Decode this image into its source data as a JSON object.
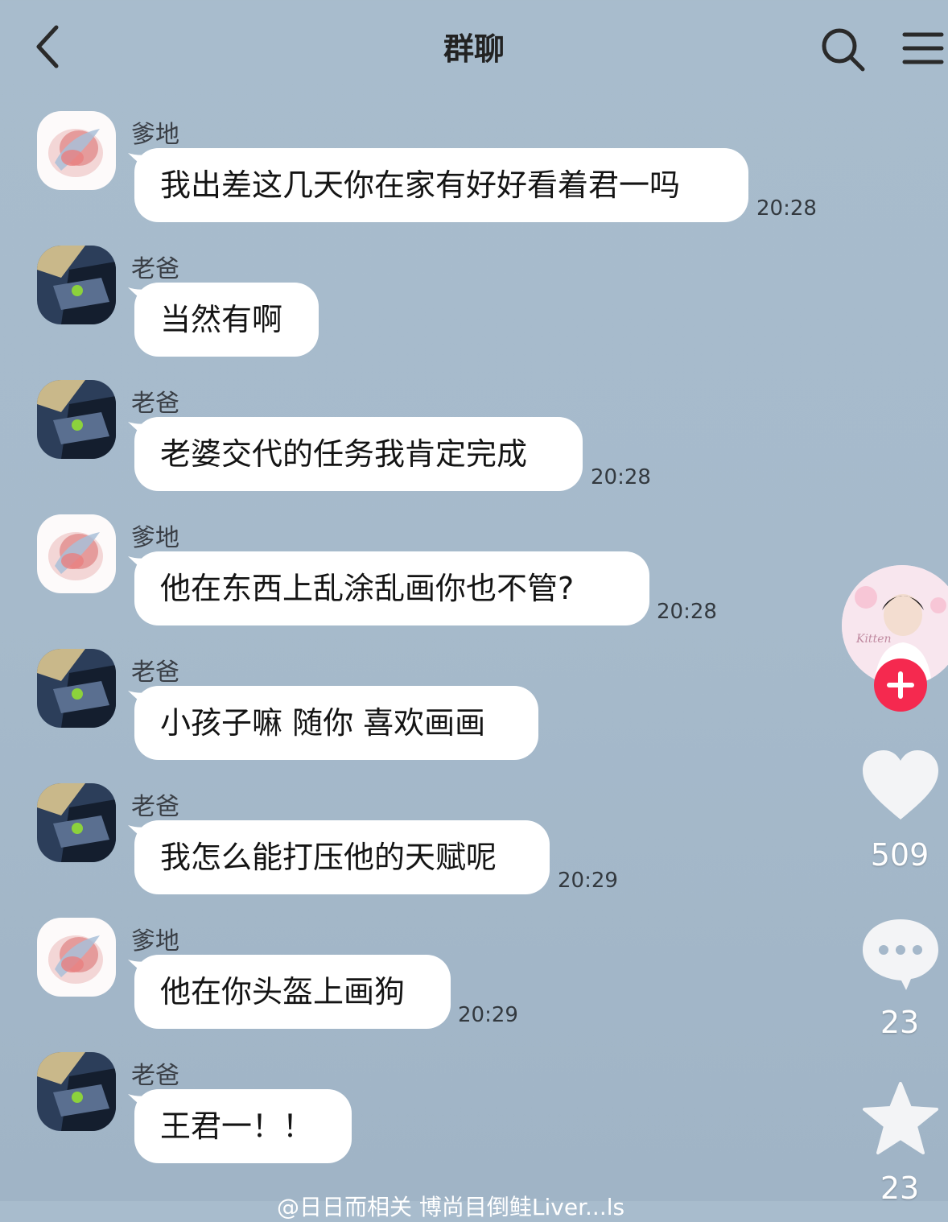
{
  "header": {
    "title": "群聊",
    "back_icon": "chevron-left-icon",
    "search_icon": "search-icon",
    "menu_icon": "menu-icon"
  },
  "messages": [
    {
      "sender": "爹地",
      "text": "我出差这几天你在家有好好看着君一吗",
      "time": "20:28",
      "avatar": "flower"
    },
    {
      "sender": "老爸",
      "text": "当然有啊",
      "time": "",
      "avatar": "car"
    },
    {
      "sender": "老爸",
      "text": "老婆交代的任务我肯定完成",
      "time": "20:28",
      "avatar": "car"
    },
    {
      "sender": "爹地",
      "text": "他在东西上乱涂乱画你也不管?",
      "time": "20:28",
      "avatar": "flower"
    },
    {
      "sender": "老爸",
      "text": "小孩子嘛 随你 喜欢画画",
      "time": "",
      "avatar": "car"
    },
    {
      "sender": "老爸",
      "text": "我怎么能打压他的天赋呢",
      "time": "20:29",
      "avatar": "car"
    },
    {
      "sender": "爹地",
      "text": "他在你头盔上画狗",
      "time": "20:29",
      "avatar": "flower"
    },
    {
      "sender": "老爸",
      "text": "王君一！！",
      "time": "",
      "avatar": "car"
    }
  ],
  "side_actions": {
    "like_count": "509",
    "comment_count": "23",
    "favorite_count": "23",
    "avatar_text": "Kitten"
  },
  "watermark": "@日日而相关 博尚目倒鲑Liver...ls",
  "colors": {
    "background": "#a8bccd",
    "bubble": "#ffffff",
    "follow_button": "#f5294f"
  }
}
